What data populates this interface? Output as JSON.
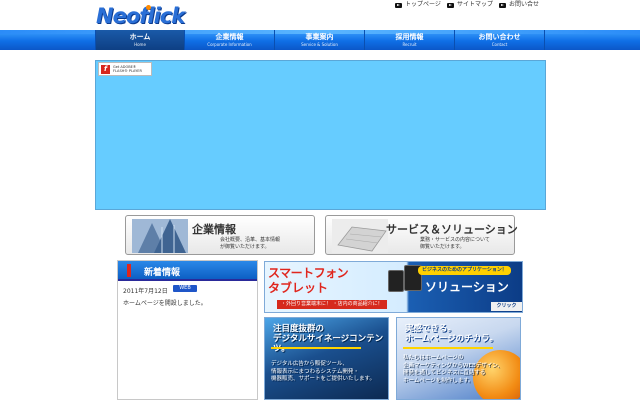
{
  "brand": {
    "logo": "Neoflick"
  },
  "utility_links": [
    {
      "label": "トップページ"
    },
    {
      "label": "サイトマップ"
    },
    {
      "label": "お問い合せ"
    }
  ],
  "nav": [
    {
      "label": "ホーム",
      "sub": "Home"
    },
    {
      "label": "企業情報",
      "sub": "Corporate Information"
    },
    {
      "label": "事業案内",
      "sub": "Service & Solution"
    },
    {
      "label": "採用情報",
      "sub": "Recruit"
    },
    {
      "label": "お問い合わせ",
      "sub": "Contact"
    }
  ],
  "flash": {
    "badge_line1": "Get ADOBE®",
    "badge_line2": "FLASH® PLAYER"
  },
  "banners": [
    {
      "title": "企業情報",
      "desc1": "会社概要、沿革、基本情報",
      "desc2": "が御覧いただけます。"
    },
    {
      "title": "サービス＆ソリューション",
      "desc1": "業務・サービスの内容について",
      "desc2": "御覧いただけます。"
    }
  ],
  "news": {
    "heading": "新着情報",
    "items": [
      {
        "date": "2011年7月12日",
        "tag": "WEB",
        "text": "ホームページを開設しました。"
      }
    ]
  },
  "promo_top": {
    "line1": "スマートフォン",
    "line2": "タブレット",
    "sub": "・外回り営業端末に！ ・店内の商品紹介に！",
    "pill": "ビジネスのためのアプリケーション！",
    "solution": "ソリューション",
    "click": "クリック"
  },
  "promo_left": {
    "head1": "注目度抜群の",
    "head2": "デジタルサイネージコンテンツ。",
    "body1": "デジタル広告から販促ツール、",
    "body2": "情報表示にまつわるシステム開発・",
    "body3": "機器販売、サポートをご提供いたします。"
  },
  "promo_right": {
    "head1": "実感できる。",
    "head2": "ホームページのチカラ。",
    "body1": "私たちはホームページの",
    "body2": "企画マーケティングからWEBデザイン、",
    "body3": "開発を通してビジネスに直結する",
    "body4": "ホームページを制作します。"
  }
}
